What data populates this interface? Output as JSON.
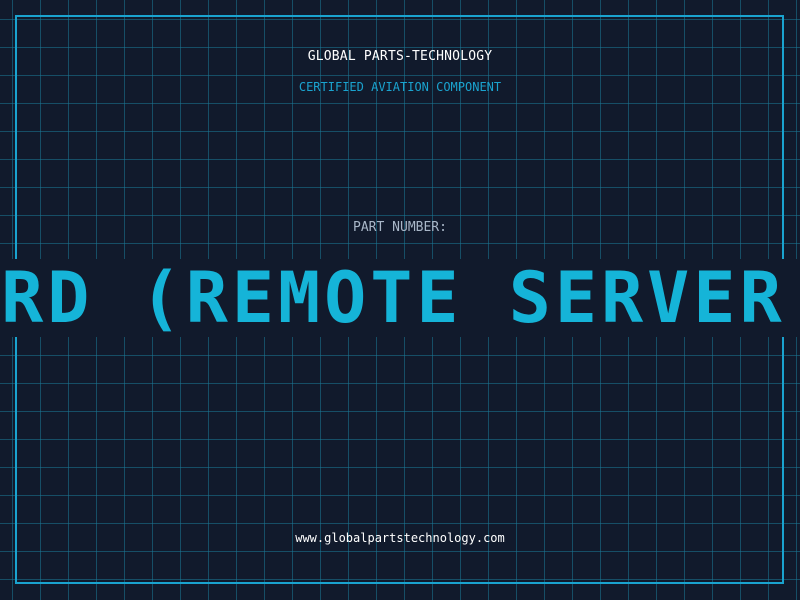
{
  "header": {
    "company": "GLOBAL PARTS-TECHNOLOGY",
    "tagline": "CERTIFIED AVIATION COMPONENT"
  },
  "part": {
    "label": "PART NUMBER:",
    "value": "ARD (REMOTE SERVER"
  },
  "footer": {
    "website": "www.globalpartstechnology.com"
  },
  "colors": {
    "background": "#111a2c",
    "accent": "#1aa3cf",
    "part_number": "#15b4d8",
    "label": "#a9b7c8",
    "text": "#ffffff"
  }
}
